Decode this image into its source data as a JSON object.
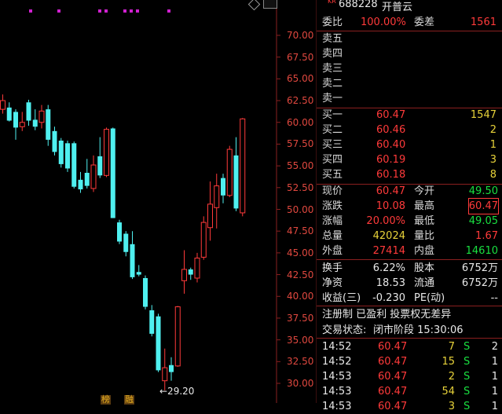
{
  "stock": {
    "tag": "KR",
    "code": "688228",
    "name": "开普云"
  },
  "y_axis_labels": [
    "70.00",
    "67.50",
    "65.00",
    "62.50",
    "60.00",
    "57.50",
    "55.00",
    "52.50",
    "50.00",
    "47.50",
    "45.00",
    "42.50",
    "40.00",
    "37.50",
    "35.00",
    "32.50",
    "30.00"
  ],
  "low_marker": "←29.20",
  "chart_data": {
    "type": "candlestick",
    "ylim": [
      29.2,
      70.0
    ],
    "colors": {
      "up": "#ff3a3a",
      "down": "#4ff0f0",
      "axis": "#8a1f1f",
      "marker": "#d020d0"
    },
    "candles": [
      {
        "o": 61.5,
        "c": 62.5,
        "h": 63.2,
        "l": 61.0
      },
      {
        "o": 61.7,
        "c": 60.2,
        "h": 62.3,
        "l": 60.1
      },
      {
        "o": 61.2,
        "c": 59.4,
        "h": 61.5,
        "l": 58.0
      },
      {
        "o": 59.5,
        "c": 60.0,
        "h": 61.2,
        "l": 59.0
      },
      {
        "o": 62.3,
        "c": 60.2,
        "h": 62.6,
        "l": 59.6
      },
      {
        "o": 60.3,
        "c": 59.5,
        "h": 61.5,
        "l": 59.1
      },
      {
        "o": 60.0,
        "c": 61.3,
        "h": 62.0,
        "l": 59.3
      },
      {
        "o": 61.5,
        "c": 58.0,
        "h": 62.0,
        "l": 57.3
      },
      {
        "o": 59.0,
        "c": 56.6,
        "h": 59.5,
        "l": 56.2
      },
      {
        "o": 57.9,
        "c": 55.2,
        "h": 58.2,
        "l": 54.8
      },
      {
        "o": 57.6,
        "c": 54.7,
        "h": 57.9,
        "l": 54.3
      },
      {
        "o": 57.6,
        "c": 52.6,
        "h": 57.8,
        "l": 52.4
      },
      {
        "o": 53.4,
        "c": 52.3,
        "h": 54.3,
        "l": 51.9
      },
      {
        "o": 54.2,
        "c": 52.7,
        "h": 55.8,
        "l": 52.4
      },
      {
        "o": 52.4,
        "c": 55.1,
        "h": 56.2,
        "l": 52.0
      },
      {
        "o": 56.1,
        "c": 53.9,
        "h": 58.3,
        "l": 53.6
      },
      {
        "o": 53.9,
        "c": 59.2,
        "h": 59.4,
        "l": 53.7
      },
      {
        "o": 59.3,
        "c": 49.0,
        "h": 59.4,
        "l": 49.0
      },
      {
        "o": 48.5,
        "c": 46.3,
        "h": 48.8,
        "l": 46.0
      },
      {
        "o": 47.2,
        "c": 45.1,
        "h": 47.5,
        "l": 44.6
      },
      {
        "o": 46.0,
        "c": 42.2,
        "h": 47.5,
        "l": 42.0
      },
      {
        "o": 42.8,
        "c": 42.5,
        "h": 43.6,
        "l": 42.3
      },
      {
        "o": 42.1,
        "c": 38.8,
        "h": 42.4,
        "l": 38.5
      },
      {
        "o": 38.4,
        "c": 35.7,
        "h": 39.0,
        "l": 35.4
      },
      {
        "o": 37.7,
        "c": 31.5,
        "h": 38.0,
        "l": 31.3
      },
      {
        "o": 30.3,
        "c": 31.8,
        "h": 34.0,
        "l": 29.2
      },
      {
        "o": 32.1,
        "c": 31.3,
        "h": 33.0,
        "l": 30.3
      },
      {
        "o": 32.0,
        "c": 38.8,
        "h": 38.9,
        "l": 31.9
      },
      {
        "o": 41.8,
        "c": 43.1,
        "h": 45.3,
        "l": 40.3
      },
      {
        "o": 43.1,
        "c": 42.5,
        "h": 43.3,
        "l": 41.9
      },
      {
        "o": 42.1,
        "c": 44.4,
        "h": 45.0,
        "l": 41.6
      },
      {
        "o": 44.5,
        "c": 48.5,
        "h": 49.2,
        "l": 44.2
      },
      {
        "o": 47.9,
        "c": 50.6,
        "h": 53.2,
        "l": 46.4
      },
      {
        "o": 50.2,
        "c": 52.7,
        "h": 54.1,
        "l": 47.8
      },
      {
        "o": 53.6,
        "c": 51.6,
        "h": 54.1,
        "l": 50.7
      },
      {
        "o": 51.6,
        "c": 56.9,
        "h": 57.3,
        "l": 51.4
      },
      {
        "o": 56.2,
        "c": 50.1,
        "h": 58.3,
        "l": 49.8
      },
      {
        "o": 49.6,
        "c": 60.4,
        "h": 60.5,
        "l": 49.2
      }
    ]
  },
  "weibi": {
    "label": "委比",
    "value": "100.00%",
    "diff_label": "委差",
    "diff_value": "1561"
  },
  "sell_orders": [
    {
      "label": "卖五",
      "price": "",
      "vol": ""
    },
    {
      "label": "卖四",
      "price": "",
      "vol": ""
    },
    {
      "label": "卖三",
      "price": "",
      "vol": ""
    },
    {
      "label": "卖二",
      "price": "",
      "vol": ""
    },
    {
      "label": "卖一",
      "price": "",
      "vol": ""
    }
  ],
  "buy_orders": [
    {
      "label": "买一",
      "price": "60.47",
      "vol": "1547"
    },
    {
      "label": "买二",
      "price": "60.46",
      "vol": "2"
    },
    {
      "label": "买三",
      "price": "60.40",
      "vol": "1"
    },
    {
      "label": "买四",
      "price": "60.19",
      "vol": "3"
    },
    {
      "label": "买五",
      "price": "60.18",
      "vol": "8"
    }
  ],
  "quote": [
    {
      "l1": "现价",
      "v1": "60.47",
      "c1": "red",
      "l2": "今开",
      "v2": "49.50",
      "c2": "green"
    },
    {
      "l1": "涨跌",
      "v1": "10.08",
      "c1": "red",
      "l2": "最高",
      "v2": "60.47",
      "c2": "red"
    },
    {
      "l1": "涨幅",
      "v1": "20.00%",
      "c1": "red",
      "l2": "最低",
      "v2": "49.05",
      "c2": "green"
    },
    {
      "l1": "总量",
      "v1": "42024",
      "c1": "yellow",
      "l2": "量比",
      "v2": "1.67",
      "c2": "red"
    },
    {
      "l1": "外盘",
      "v1": "27414",
      "c1": "red",
      "l2": "内盘",
      "v2": "14610",
      "c2": "green"
    }
  ],
  "stats": [
    {
      "l1": "换手",
      "v1": "6.22%",
      "l2": "股本",
      "v2": "6752万"
    },
    {
      "l1": "净资",
      "v1": "18.53",
      "l2": "流通",
      "v2": "6752万"
    },
    {
      "l1": "收益(三)",
      "v1": "-0.230",
      "l2": "PE(动)",
      "v2": "--"
    }
  ],
  "flags_text": "注册制 已盈利 投票权无差异",
  "status": {
    "label": "交易状态:",
    "value": "闭市阶段 15:30:06"
  },
  "ticks": [
    {
      "time": "14:52",
      "price": "60.47",
      "vol": "7",
      "side": "S",
      "n": "2"
    },
    {
      "time": "14:52",
      "price": "60.47",
      "vol": "15",
      "side": "S",
      "n": "1"
    },
    {
      "time": "14:53",
      "price": "60.47",
      "vol": "2",
      "side": "S",
      "n": "1"
    },
    {
      "time": "14:53",
      "price": "60.47",
      "vol": "54",
      "side": "S",
      "n": "1"
    },
    {
      "time": "14:53",
      "price": "60.47",
      "vol": "3",
      "side": "S",
      "n": "1"
    }
  ],
  "bottom_marks": [
    "榜",
    "融"
  ]
}
